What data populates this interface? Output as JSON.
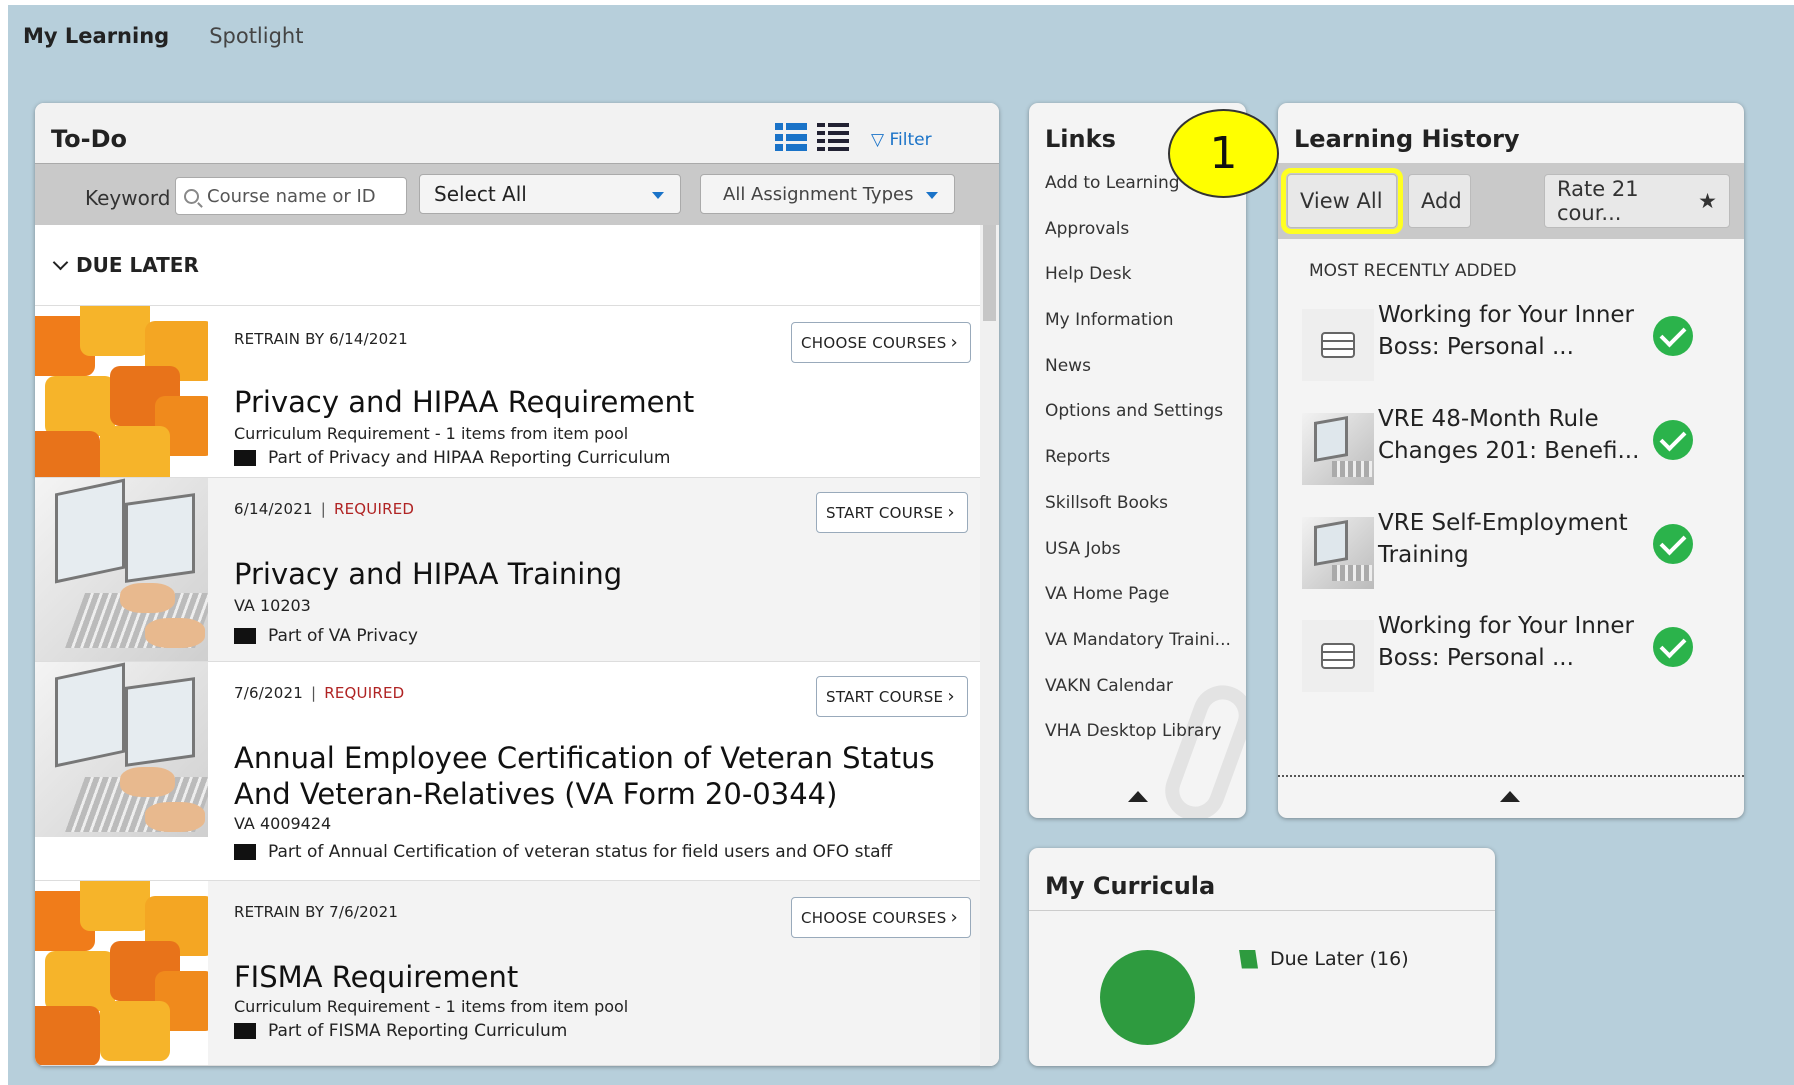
{
  "top_tabs": [
    {
      "label": "My Learning"
    },
    {
      "label": "Spotlight"
    }
  ],
  "todo": {
    "title": "To-Do",
    "filter_label": "Filter",
    "keyword_label": "Keyword",
    "keyword_placeholder": "Course name or ID",
    "select_all": "Select All",
    "assignment_types": "All Assignment Types",
    "group_label": "DUE LATER",
    "items": [
      {
        "meta": "RETRAIN BY 6/14/2021",
        "required": "",
        "title": "Privacy and HIPAA Requirement",
        "sub": "Curriculum Requirement - 1 items from item pool",
        "part": "Part of Privacy and HIPAA Reporting Curriculum",
        "button": "CHOOSE COURSES"
      },
      {
        "meta": "6/14/2021",
        "required": "REQUIRED",
        "title": "Privacy and HIPAA Training",
        "sub": "VA 10203",
        "part": "Part of VA Privacy",
        "button": "START COURSE"
      },
      {
        "meta": "7/6/2021",
        "required": "REQUIRED",
        "title": "Annual Employee Certification of Veteran Status And Veteran-Relatives (VA Form 20-0344)",
        "sub": "VA 4009424",
        "part": "Part of Annual Certification of veteran status for field users and OFO staff",
        "button": "START COURSE"
      },
      {
        "meta": "RETRAIN BY 7/6/2021",
        "required": "",
        "title": "FISMA Requirement",
        "sub": "Curriculum Requirement - 1 items from item pool",
        "part": "Part of FISMA Reporting Curriculum",
        "button": "CHOOSE COURSES"
      }
    ]
  },
  "links": {
    "title": "Links",
    "items": [
      "Add to Learning",
      "Approvals",
      "Help Desk",
      "My Information",
      "News",
      "Options and Settings",
      "Reports",
      "Skillsoft Books",
      "USA Jobs",
      "VA Home Page",
      "VA Mandatory Traini...",
      "VAKN Calendar",
      "VHA Desktop Library"
    ]
  },
  "callout_number": "1",
  "history": {
    "title": "Learning History",
    "view_all": "View All",
    "add": "Add",
    "rate": "Rate 21 cour...",
    "rate_star": "★",
    "section_label": "MOST RECENTLY ADDED",
    "items": [
      {
        "text": "Working for Your Inner Boss: Personal ...",
        "icon": "stack-icon"
      },
      {
        "text": "VRE 48-Month Rule Changes 201: Benefi...",
        "icon": "computer-icon"
      },
      {
        "text": "VRE Self-Employment Training",
        "icon": "computer-icon"
      },
      {
        "text": "Working for Your Inner Boss: Personal ...",
        "icon": "stack-icon"
      }
    ]
  },
  "curricula": {
    "title": "My Curricula",
    "legend": "Due Later (16)",
    "color": "#2e9b3f"
  },
  "chart_data": {
    "type": "pie",
    "categories": [
      "Due Later"
    ],
    "values": [
      16
    ],
    "title": "",
    "legend": [
      "Due Later (16)"
    ]
  },
  "colors": {
    "background": "#b7cfdb",
    "accent": "#1a73c8",
    "required": "#b02323",
    "check": "#2bb34b",
    "highlight": "#ffff00"
  }
}
